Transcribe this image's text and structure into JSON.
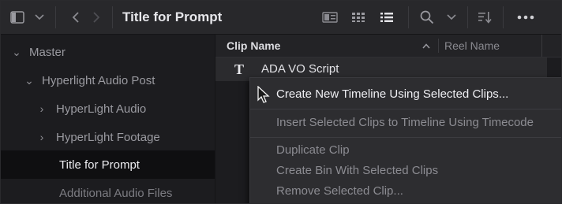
{
  "toolbar": {
    "title": "Title for Prompt",
    "icons": [
      "sidebar-toggle-icon",
      "chevron-down-icon",
      "back-arrow-icon",
      "forward-arrow-icon",
      "thumbnail-view-icon",
      "grid-view-icon",
      "list-view-icon",
      "search-icon",
      "chevron-down-icon",
      "sort-icon",
      "more-options-icon"
    ]
  },
  "sidebar": {
    "items": [
      {
        "label": "Master",
        "chevron": "⌄"
      },
      {
        "label": "Hyperlight Audio Post",
        "chevron": "⌄"
      },
      {
        "label": "HyperLight Audio",
        "chevron": "›"
      },
      {
        "label": "HyperLight Footage",
        "chevron": "›"
      },
      {
        "label": "Title for Prompt",
        "chevron": ""
      },
      {
        "label": "Additional Audio Files",
        "chevron": ""
      }
    ]
  },
  "clip_list": {
    "columns": {
      "clip_name": "Clip Name",
      "reel_name": "Reel Name",
      "sort_indicator": "^"
    },
    "rows": [
      {
        "type_glyph": "T",
        "name": "ADA VO Script"
      }
    ]
  },
  "context_menu": {
    "items": [
      {
        "label": "Create New Timeline Using Selected Clips...",
        "enabled": true
      },
      {
        "label": "Insert Selected Clips to Timeline Using Timecode",
        "enabled": false
      },
      {
        "label": "Duplicate Clip",
        "enabled": false
      },
      {
        "label": "Create Bin With Selected Clips",
        "enabled": false
      },
      {
        "label": "Remove Selected Clip...",
        "enabled": false
      }
    ]
  },
  "colors": {
    "background": "#1e1e21",
    "toolbar": "#28282b",
    "selected_row": "#0f0f11",
    "menu": "#2d2d30",
    "active_text": "#f0f0f4",
    "disabled_text": "#8c8c92"
  }
}
